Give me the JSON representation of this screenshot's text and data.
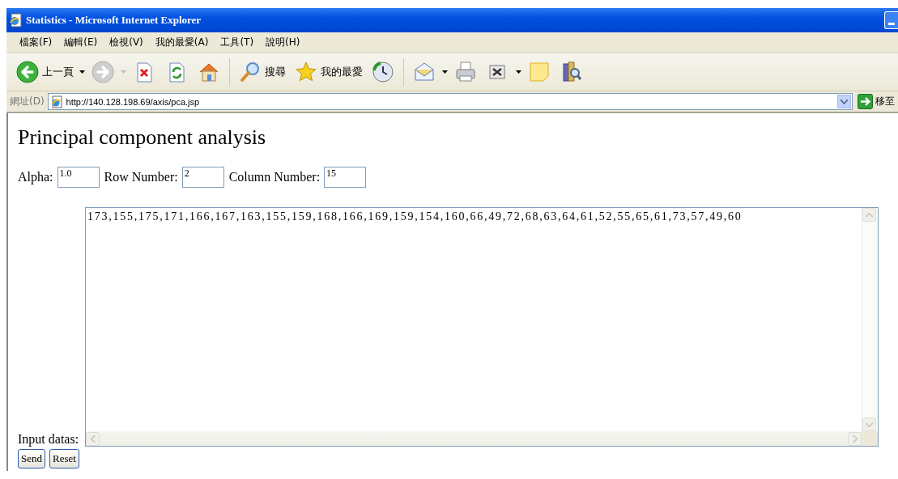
{
  "window": {
    "title": "Statistics - Microsoft Internet Explorer"
  },
  "menu": [
    {
      "label": "檔案(F)"
    },
    {
      "label": "編輯(E)"
    },
    {
      "label": "檢視(V)"
    },
    {
      "label": "我的最愛(A)"
    },
    {
      "label": "工具(T)"
    },
    {
      "label": "說明(H)"
    }
  ],
  "toolbar": [
    {
      "kind": "back",
      "label": "上一頁",
      "dropdown": true
    },
    {
      "kind": "forward",
      "dropdown": true
    },
    {
      "kind": "stop"
    },
    {
      "kind": "refresh"
    },
    {
      "kind": "home"
    },
    {
      "kind": "separator"
    },
    {
      "kind": "search",
      "label": "搜尋"
    },
    {
      "kind": "favorites",
      "label": "我的最愛"
    },
    {
      "kind": "history"
    },
    {
      "kind": "separator"
    },
    {
      "kind": "mail",
      "dropdown": true
    },
    {
      "kind": "print"
    },
    {
      "kind": "edit",
      "dropdown": true
    },
    {
      "kind": "note"
    },
    {
      "kind": "research"
    }
  ],
  "address_bar": {
    "label": "網址(D)",
    "url": "http://140.128.198.69/axis/pca.jsp",
    "go": "移至"
  },
  "page": {
    "heading": "Principal component analysis",
    "fields": [
      {
        "label": "Alpha:",
        "value": "1.0"
      },
      {
        "label": "Row Number:",
        "value": "2"
      },
      {
        "label": "Column Number:",
        "value": "15"
      }
    ],
    "data_label": "Input datas:",
    "data_value": "173,155,175,171,166,167,163,155,159,168,166,169,159,154,160,66,49,72,68,63,64,61,52,55,65,61,73,57,49,60",
    "buttons": [
      {
        "label": "Send"
      },
      {
        "label": "Reset"
      }
    ]
  }
}
